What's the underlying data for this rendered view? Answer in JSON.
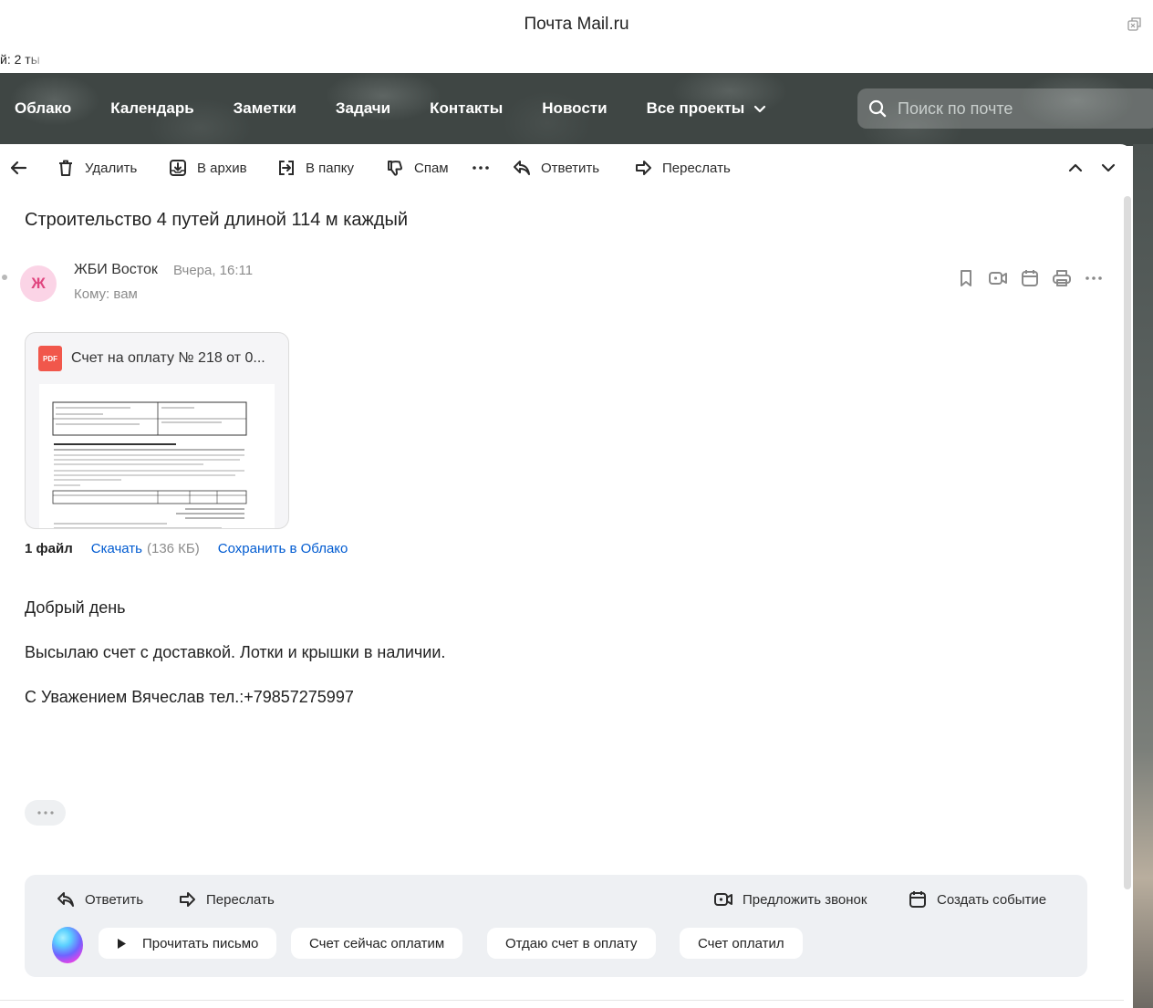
{
  "window": {
    "title": "Почта Mail.ru",
    "clipped_text": "й: 2 ты"
  },
  "nav": {
    "items": [
      "Облако",
      "Календарь",
      "Заметки",
      "Задачи",
      "Контакты",
      "Новости",
      "Все проекты"
    ],
    "search_placeholder": "Поиск по почте"
  },
  "toolbar": {
    "delete": "Удалить",
    "archive": "В архив",
    "move": "В папку",
    "spam": "Спам",
    "reply": "Ответить",
    "forward": "Переслать"
  },
  "message": {
    "subject": "Строительство 4 путей длиной 114 м каждый",
    "avatar_letter": "Ж",
    "sender": "ЖБИ Восток",
    "date": "Вчера, 16:11",
    "to": "Кому: вам",
    "attachment": {
      "name": "Счет на оплату № 218 от 0...",
      "type_label": "PDF",
      "files_count": "1 файл",
      "download": "Скачать",
      "size": "(136 КБ)",
      "save_cloud": "Сохранить в Облако"
    },
    "body": [
      "Добрый день",
      "Высылаю счет с доставкой. Лотки и крышки в наличии.",
      "С Уважением Вячеслав тел.:+79857275997"
    ]
  },
  "reply_box": {
    "reply": "Ответить",
    "forward": "Переслать",
    "suggest_call": "Предложить звонок",
    "create_event": "Создать событие",
    "chips": [
      "Прочитать письмо",
      "Счет сейчас оплатим",
      "Отдаю счет в оплату",
      "Счет оплатил"
    ]
  },
  "colors": {
    "accent_link": "#005bd1",
    "avatar_bg": "#fbd4e6",
    "avatar_fg": "#e0467f",
    "pdf_red": "#f1574b"
  }
}
